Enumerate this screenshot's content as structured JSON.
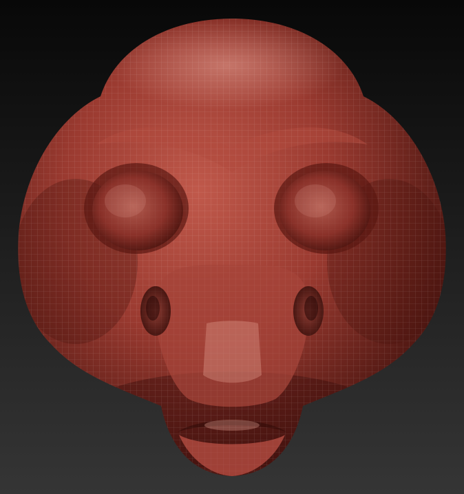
{
  "scene": {
    "subject": "sculpted-head-mesh",
    "background_top_color": "#080808",
    "background_bottom_color": "#353535",
    "material_color": "#9a3a30",
    "material_highlight_color": "#e6a396",
    "material_shadow_color": "#3a0e0a",
    "wireframe_color": "#ffffff"
  }
}
